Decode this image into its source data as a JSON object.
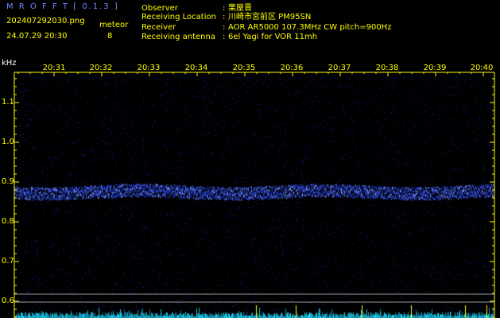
{
  "header": {
    "app_title": "M R O F F T  [ 0.1.3 ]",
    "filename": "202407292030.png",
    "datetime": "24.07.29 20:30",
    "meteor_label": "meteor",
    "meteor_count": "8"
  },
  "info": [
    {
      "key": "Observer",
      "value": "栗屋晋"
    },
    {
      "key": "Receiving Location",
      "value": "川崎市宮前区  PM95SN"
    },
    {
      "key": "Receiver",
      "value": "AOR AR5000  107.3MHz CW pitch=900Hz"
    },
    {
      "key": "Receiving antenna",
      "value": "6el Yagi for VOR 11mh"
    }
  ],
  "axis": {
    "y_unit": "kHz",
    "x_ticks": [
      "20:31",
      "20:32",
      "20:33",
      "20:34",
      "20:35",
      "20:36",
      "20:37",
      "20:38",
      "20:39",
      "20:40"
    ],
    "y_ticks": [
      "1.1",
      "1.0",
      "0.9",
      "0.8",
      "0.7",
      "0.6"
    ]
  },
  "colors": {
    "label_yellow": "#ffff00",
    "signal_blue": "#3f63ff",
    "background": "#000000",
    "band_cyan": "#19d9ff"
  }
}
